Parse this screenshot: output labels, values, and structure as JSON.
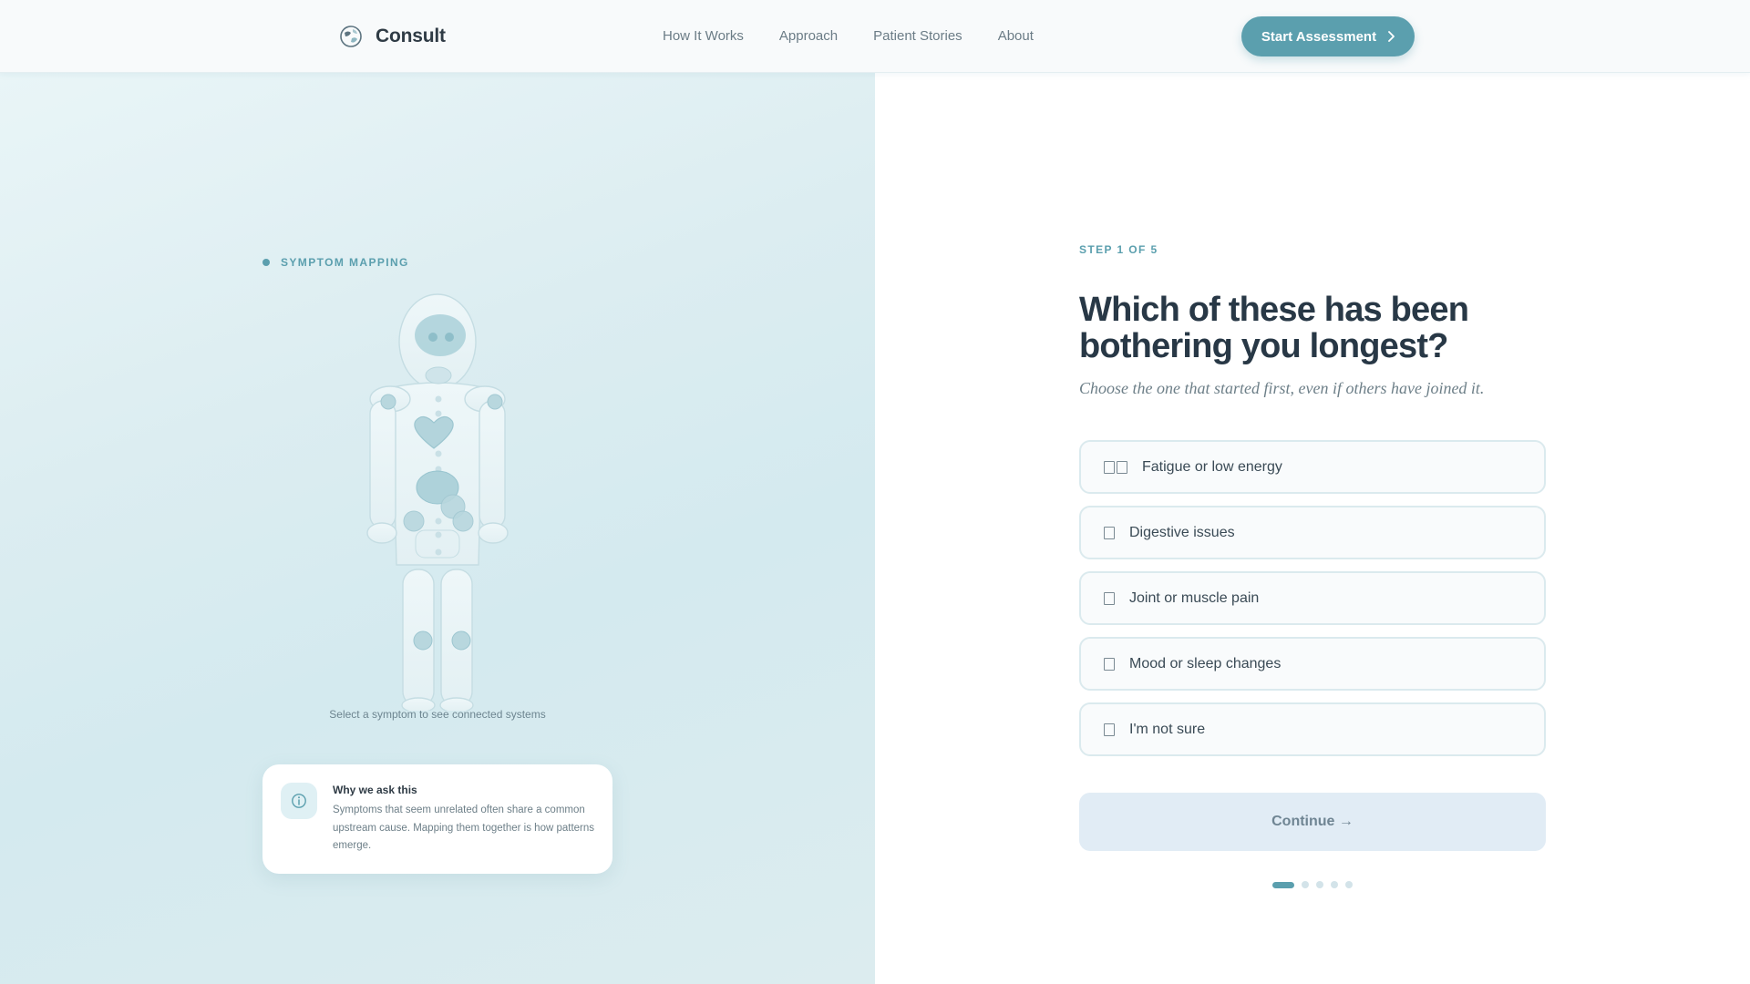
{
  "header": {
    "brand": "Consult",
    "nav": [
      "How It Works",
      "Approach",
      "Patient Stories",
      "About"
    ],
    "cta_label": "Start Assessment"
  },
  "left_panel": {
    "tag": "SYMPTOM MAPPING",
    "figure_caption": "Select a symptom to see connected systems",
    "info_card": {
      "title": "Why we ask this",
      "body": "Symptoms that seem unrelated often share a common upstream cause. Mapping them together is how patterns emerge."
    }
  },
  "right_panel": {
    "step_label": "STEP 1 OF 5",
    "question": "Which of these has been bothering you longest?",
    "subtitle": "Choose the one that started first, even if others have joined it.",
    "options": [
      {
        "label": "Fatigue or low energy",
        "icon": "double-square-icon"
      },
      {
        "label": "Digestive issues",
        "icon": "square-icon"
      },
      {
        "label": "Joint or muscle pain",
        "icon": "square-icon"
      },
      {
        "label": "Mood or sleep changes",
        "icon": "square-icon"
      },
      {
        "label": "I'm not sure",
        "icon": "square-icon"
      }
    ],
    "continue_label": "Continue →",
    "progress": {
      "current": 1,
      "total": 5
    }
  },
  "colors": {
    "accent": "#5b9fae",
    "heading": "#283846",
    "panel_bg": "#dcedf1",
    "continue_bg": "#e1ecf5"
  }
}
